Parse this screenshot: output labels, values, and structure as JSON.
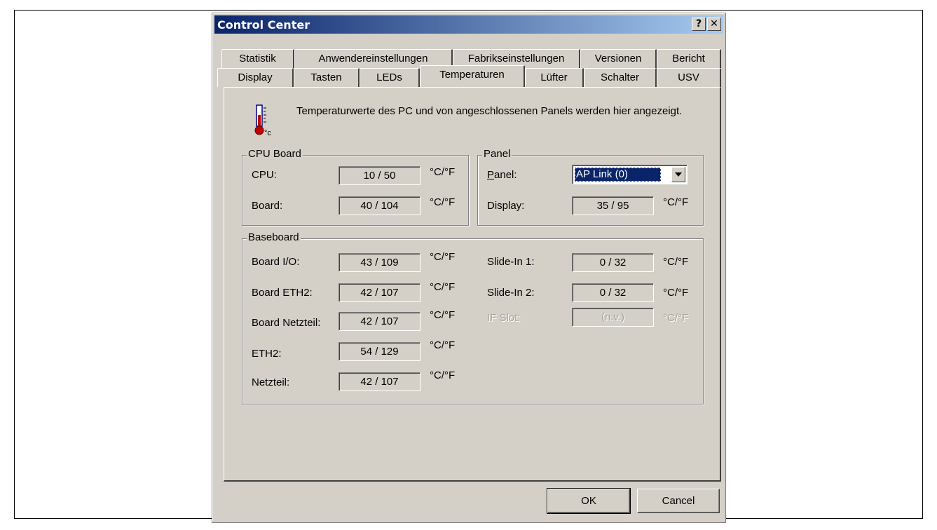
{
  "window": {
    "title": "Control Center",
    "help_label": "?",
    "close_label": "✕"
  },
  "tabs_row1": [
    "Statistik",
    "Anwendereinstellungen",
    "Fabrikseinstellungen",
    "Versionen",
    "Bericht"
  ],
  "tabs_row2": [
    "Display",
    "Tasten",
    "LEDs",
    "Temperaturen",
    "Lüfter",
    "Schalter",
    "USV"
  ],
  "active_tab": "Temperaturen",
  "info": {
    "icon": "thermometer-icon",
    "text": "Temperaturwerte des PC und von angeschlossenen Panels werden hier angezeigt.",
    "icon_unit": "°c"
  },
  "cpu_board": {
    "title": "CPU Board",
    "rows": [
      {
        "label": "CPU:",
        "value": "10 / 50",
        "unit": "°C/°F"
      },
      {
        "label": "Board:",
        "value": "40 / 104",
        "unit": "°C/°F"
      }
    ]
  },
  "panel_group": {
    "title": "Panel",
    "panel_label_first": "P",
    "panel_label_rest": "anel:",
    "panel_selected": "AP Link (0)",
    "display_label": "Display:",
    "display_value": "35 / 95",
    "display_unit": "°C/°F"
  },
  "baseboard": {
    "title": "Baseboard",
    "left": [
      {
        "label": "Board I/O:",
        "value": "43 / 109",
        "unit": "°C/°F"
      },
      {
        "label": "Board ETH2:",
        "value": "42 / 107",
        "unit": "°C/°F"
      },
      {
        "label": "Board Netzteil:",
        "value": "42 / 107",
        "unit": "°C/°F"
      },
      {
        "label": "ETH2:",
        "value": "54 / 129",
        "unit": "°C/°F"
      },
      {
        "label": "Netzteil:",
        "value": "42 / 107",
        "unit": "°C/°F"
      }
    ],
    "right": [
      {
        "label": "Slide-In 1:",
        "value": "0 / 32",
        "unit": "°C/°F"
      },
      {
        "label": "Slide-In 2:",
        "value": "0 / 32",
        "unit": "°C/°F"
      },
      {
        "label": "IF Slot:",
        "value": "(n.v.)",
        "unit": "°C/°F",
        "disabled": true
      }
    ]
  },
  "buttons": {
    "ok": "OK",
    "cancel": "Cancel"
  }
}
